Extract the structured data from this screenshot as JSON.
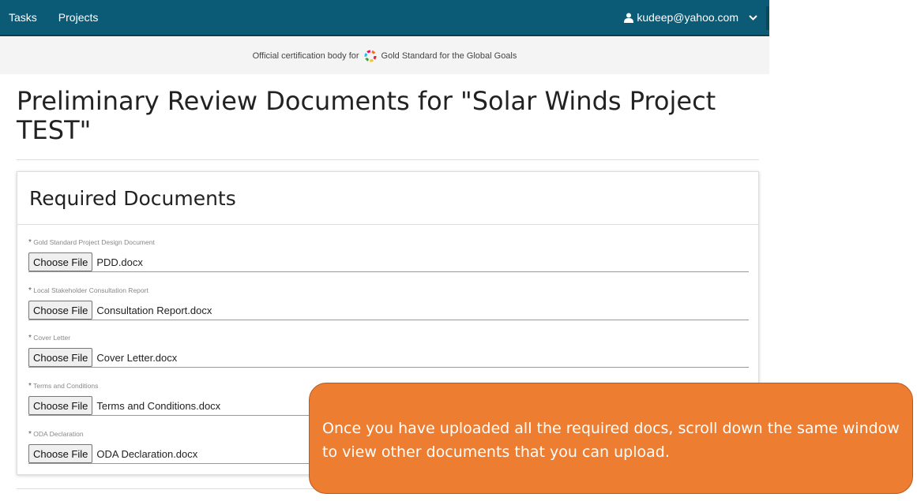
{
  "navbar": {
    "links": [
      "Tasks",
      "Projects"
    ],
    "user_email": "kudeep@yahoo.com"
  },
  "cert_bar": {
    "prefix": "Official certification body for",
    "org_name": "Gold Standard for the Global Goals"
  },
  "page_title": "Preliminary Review Documents for \"Solar Winds Project TEST\"",
  "panel": {
    "title": "Required Documents",
    "button_label": "Choose File",
    "required_marker": "*",
    "fields": [
      {
        "label": "Gold Standard Project Design Document",
        "file": "PDD.docx"
      },
      {
        "label": "Local Stakeholder Consultation Report",
        "file": "Consultation Report.docx"
      },
      {
        "label": "Cover Letter",
        "file": "Cover Letter.docx"
      },
      {
        "label": "Terms and Conditions",
        "file": "Terms and Conditions.docx"
      },
      {
        "label": "ODA Declaration",
        "file": "ODA Declaration.docx"
      }
    ]
  },
  "callout": {
    "text": "Once you have uploaded all the required docs, scroll down the same window to view other documents that you can upload."
  },
  "colors": {
    "navbar": "#0b5a76",
    "callout": "#ed7d31"
  }
}
